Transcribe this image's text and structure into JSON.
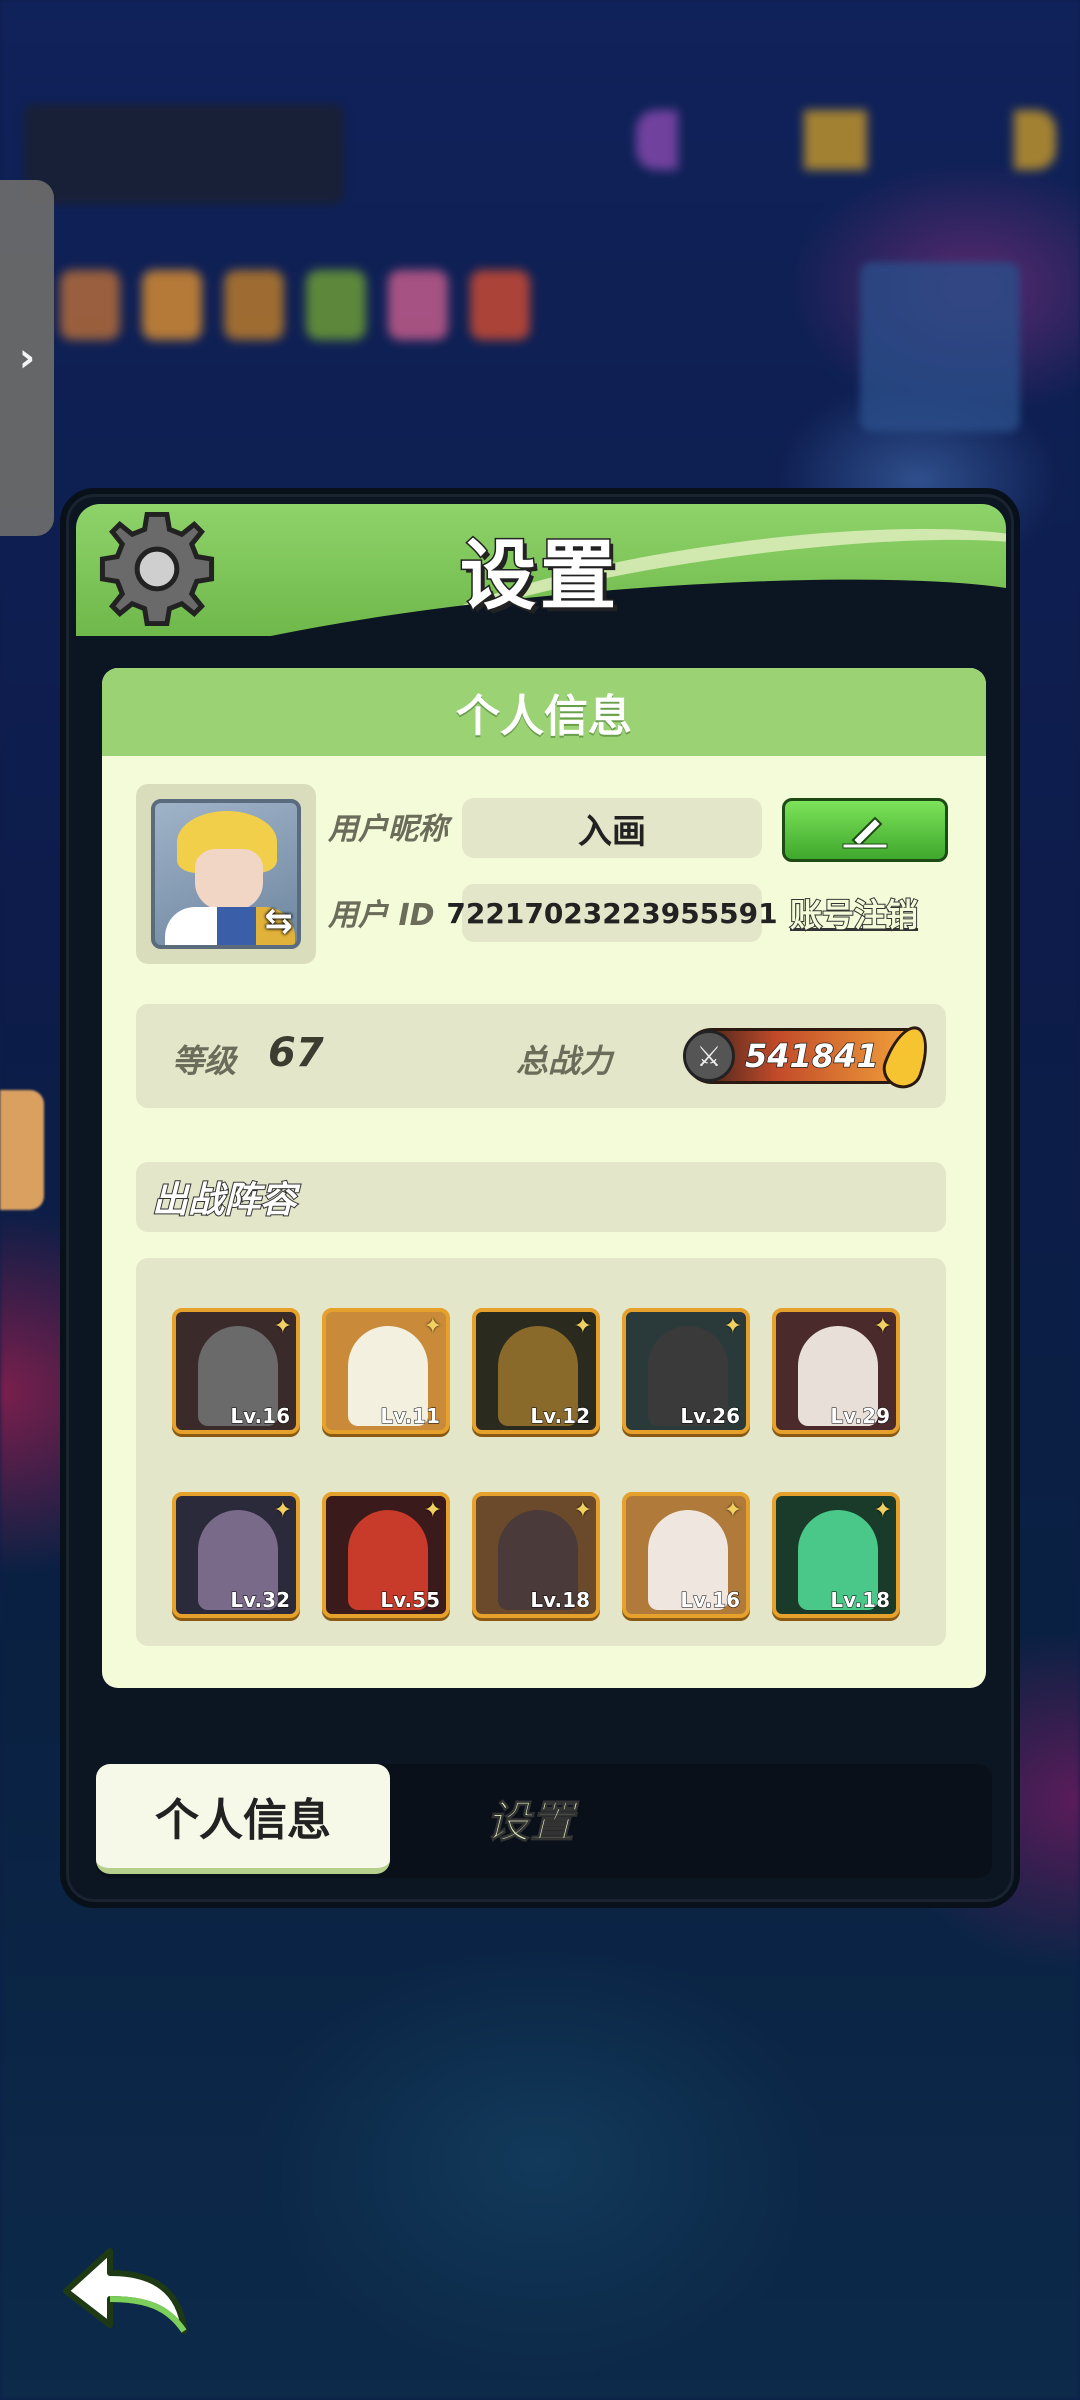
{
  "window": {
    "title": "设置"
  },
  "side_drawer": {
    "icon": "chevron-right-icon",
    "glyph": "›"
  },
  "info_card": {
    "header": "个人信息",
    "nickname_label": "用户昵称",
    "nickname_value": "入画",
    "user_id_label": "用户 ID",
    "user_id_value": "72217023223955591",
    "edit_icon": "pencil-icon",
    "cancel_account_link": "账号注销",
    "level_label": "等级",
    "level_value": "67",
    "power_label": "总战力",
    "power_value": "541841"
  },
  "lineup": {
    "title": "出战阵容",
    "heroes": [
      {
        "level": "Lv.16",
        "color": "#3a2a2a",
        "fig": "#6a6a6a"
      },
      {
        "level": "Lv.11",
        "color": "#c98a3a",
        "fig": "#f4f0e0"
      },
      {
        "level": "Lv.12",
        "color": "#2a2a1e",
        "fig": "#8a6a2a"
      },
      {
        "level": "Lv.26",
        "color": "#2a3a3a",
        "fig": "#3a3a3a"
      },
      {
        "level": "Lv.29",
        "color": "#4a2a2a",
        "fig": "#e8e0d8"
      },
      {
        "level": "Lv.32",
        "color": "#2a2a3a",
        "fig": "#7a6a8a"
      },
      {
        "level": "Lv.55",
        "color": "#3a1a1a",
        "fig": "#c83a2a"
      },
      {
        "level": "Lv.18",
        "color": "#6a4a2a",
        "fig": "#4a3a3a"
      },
      {
        "level": "Lv.16",
        "color": "#b07a3a",
        "fig": "#f0e6e0"
      },
      {
        "level": "Lv.18",
        "color": "#1a3a2a",
        "fig": "#4ac88a"
      }
    ]
  },
  "tabs": {
    "active": "个人信息",
    "inactive": "设置"
  },
  "colors": {
    "header_green": "#8ed36a",
    "card_bg": "#f3fbd8",
    "frame_orange": "#e6a12c",
    "button_green": "#3fa92d"
  }
}
